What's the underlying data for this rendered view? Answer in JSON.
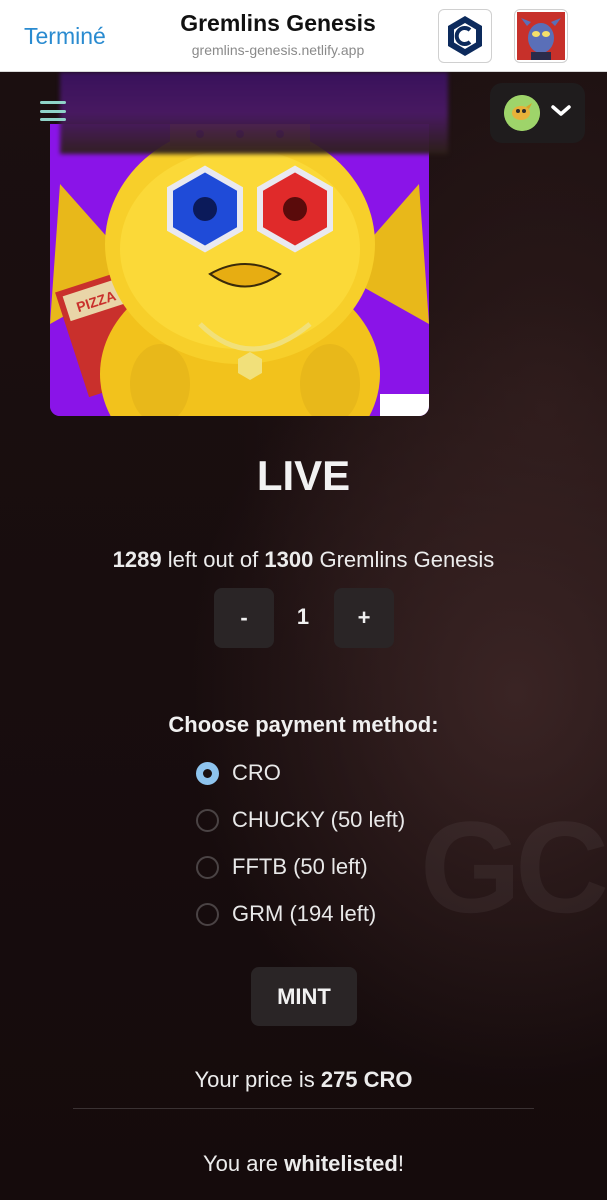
{
  "browser": {
    "done_label": "Terminé",
    "title": "Gremlins Genesis",
    "url": "gremlins-genesis.netlify.app",
    "icons": [
      "cronos-icon",
      "gremlin-avatar-icon"
    ]
  },
  "nav": {
    "menu_icon": "hamburger-menu-icon",
    "wallet_icon": "wallet-avatar-icon",
    "chevron_icon": "chevron-down-icon"
  },
  "hero": {
    "image_subject": "yellow gremlin with crown, hex glasses and pizza box on purple background"
  },
  "mint": {
    "status": "LIVE",
    "remaining": "1289",
    "left_out_of": "left out of",
    "total": "1300",
    "collection": "Gremlins Genesis",
    "decrement_label": "-",
    "quantity": "1",
    "increment_label": "+"
  },
  "payment": {
    "title": "Choose payment method:",
    "selected": "CRO",
    "options": [
      {
        "label": "CRO"
      },
      {
        "label": "CHUCKY (50 left)"
      },
      {
        "label": "FFTB (50 left)"
      },
      {
        "label": "GRM (194 left)"
      }
    ]
  },
  "actions": {
    "mint_label": "MINT"
  },
  "price": {
    "prefix": "Your price is",
    "amount": "275 CRO"
  },
  "whitelist": {
    "prefix": "You are",
    "status": "whitelisted",
    "suffix": "!"
  },
  "colors": {
    "accent": "#2a8bd0",
    "radio_checked": "#8ec4ee",
    "background": "#150b0c",
    "button_bg": "#2a2526"
  }
}
